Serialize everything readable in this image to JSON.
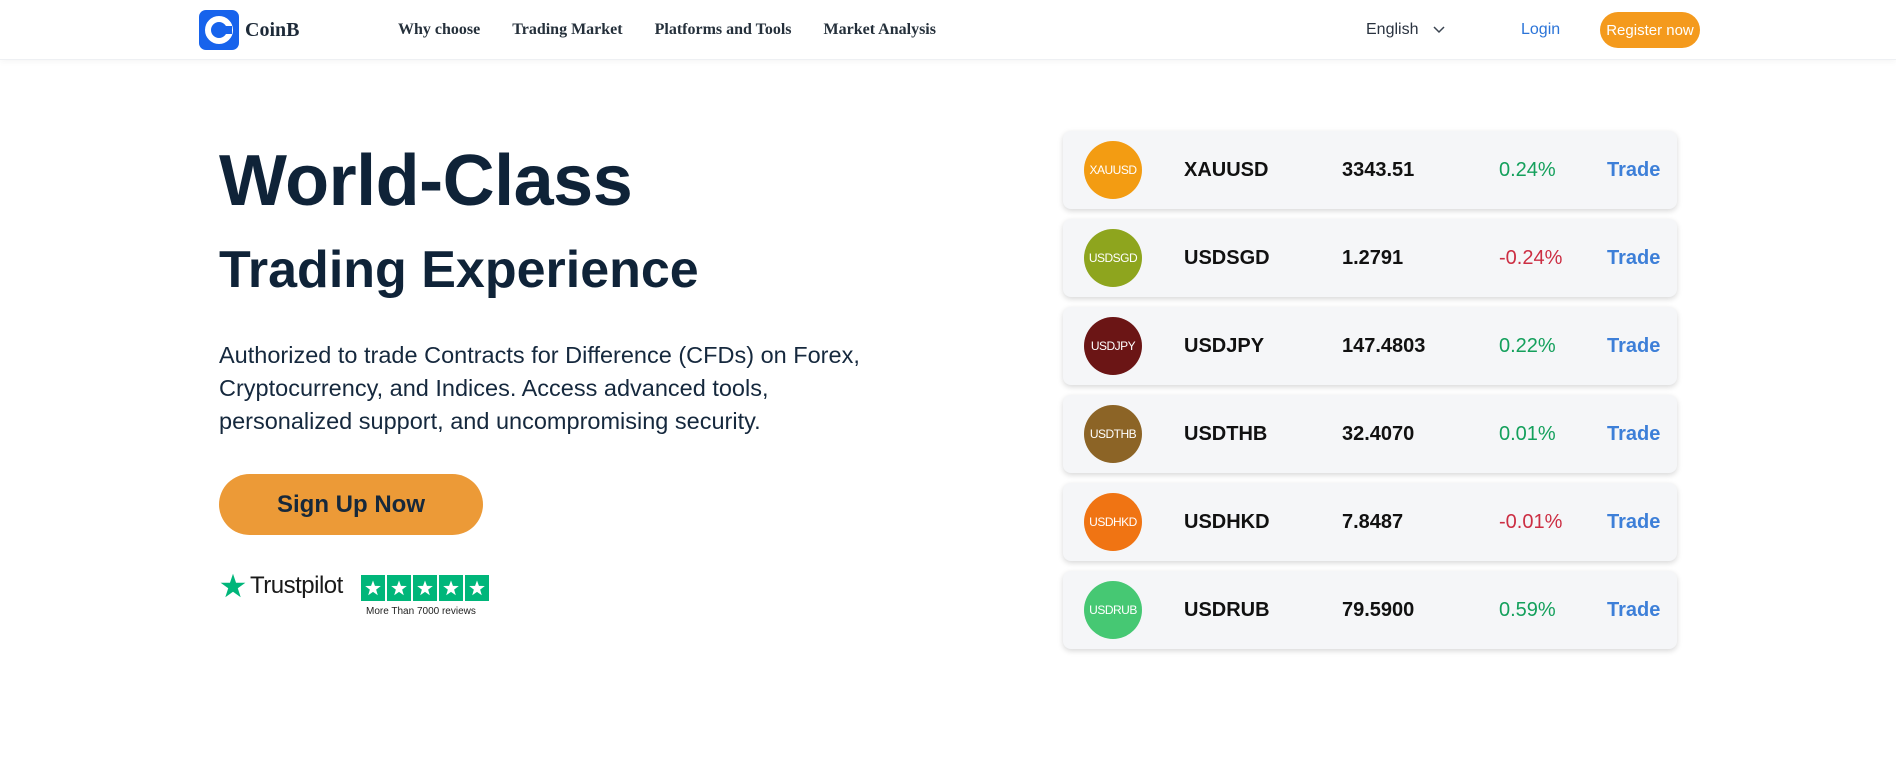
{
  "header": {
    "logo_text": "CoinB",
    "nav": [
      {
        "label": "Why choose"
      },
      {
        "label": "Trading Market"
      },
      {
        "label": "Platforms and Tools"
      },
      {
        "label": "Market Analysis"
      }
    ],
    "language": "English",
    "login_label": "Login",
    "register_label": "Register now"
  },
  "hero": {
    "title_line1": "World-Class",
    "title_line2": "Trading Experience",
    "description": "Authorized to trade Contracts for Difference (CFDs) on Forex, Cryptocurrency, and Indices. Access advanced tools, personalized support, and uncompromising security.",
    "signup_label": "Sign Up Now"
  },
  "trustpilot": {
    "brand": "Trustpilot",
    "stars": 5,
    "reviews_text": "More Than 7000 reviews"
  },
  "market": {
    "trade_label": "Trade",
    "rows": [
      {
        "badge": "XAUUSD",
        "symbol": "XAUUSD",
        "price": "3343.51",
        "change": "0.24%",
        "direction": "up",
        "color": "#f39c12"
      },
      {
        "badge": "USDSGD",
        "symbol": "USDSGD",
        "price": "1.2791",
        "change": "-0.24%",
        "direction": "down",
        "color": "#8ea51e"
      },
      {
        "badge": "USDJPY",
        "symbol": "USDJPY",
        "price": "147.4803",
        "change": "0.22%",
        "direction": "up",
        "color": "#6b1515"
      },
      {
        "badge": "USDTHB",
        "symbol": "USDTHB",
        "price": "32.4070",
        "change": "0.01%",
        "direction": "up",
        "color": "#8c6426"
      },
      {
        "badge": "USDHKD",
        "symbol": "USDHKD",
        "price": "7.8487",
        "change": "-0.01%",
        "direction": "down",
        "color": "#f07413"
      },
      {
        "badge": "USDRUB",
        "symbol": "USDRUB",
        "price": "79.5900",
        "change": "0.59%",
        "direction": "up",
        "color": "#46c873"
      }
    ]
  },
  "colors": {
    "brand_blue": "#1763ec",
    "accent_orange": "#f49a1d",
    "up_green": "#14a05c",
    "down_red": "#cc2e43",
    "trustpilot_green": "#00b67a"
  }
}
